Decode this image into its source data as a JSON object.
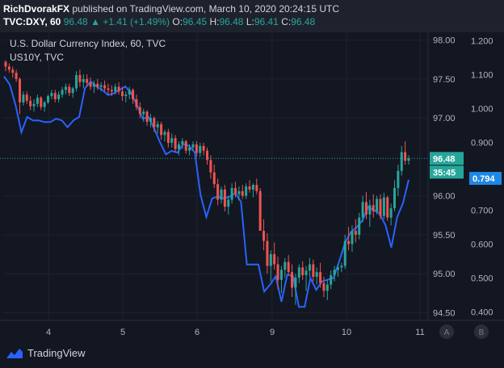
{
  "header": {
    "author": "RichDvorakFX",
    "published_text": "published on TradingView.com, March 10, 2020 20:24:15 UTC",
    "symbol": "TVC:DXY, 60",
    "last": "96.48",
    "arrow": "▲",
    "change": "+1.41 (+1.49%)",
    "open_label": "O:",
    "open": "96.45",
    "high_label": "H:",
    "high": "96.48",
    "low_label": "L:",
    "low": "96.41",
    "close_label": "C:",
    "close": "96.48"
  },
  "legend": {
    "main_series": "U.S. Dollar Currency Index, 60, TVC",
    "overlay_series": "US10Y, TVC"
  },
  "footer": {
    "brand": "TradingView"
  },
  "axis_buttons": [
    "A",
    "B"
  ],
  "colors": {
    "background": "#131722",
    "up": "#26a69a",
    "down": "#ef5350",
    "overlay": "#2962ff",
    "price_tag": "#26a69a",
    "overlay_tag": "#1e88e5"
  },
  "chart_data": {
    "type": "candlestick",
    "x_ticks": [
      "4",
      "5",
      "6",
      "9",
      "10",
      "11"
    ],
    "left_axis": {
      "ticks": [
        "98.00",
        "97.50",
        "97.00",
        "96.00",
        "95.50",
        "95.00",
        "94.50"
      ],
      "range": [
        94.4,
        98.1
      ]
    },
    "right_axis": {
      "ticks": [
        "1.200",
        "1.100",
        "1.000",
        "0.900",
        "0.800",
        "0.700",
        "0.600",
        "0.500",
        "0.400"
      ],
      "range": [
        0.375,
        1.225
      ]
    },
    "price_label": "96.48",
    "countdown_label": "35:45",
    "overlay_label": "0.794",
    "candles": [
      [
        97.72,
        97.74,
        97.6,
        97.66
      ],
      [
        97.66,
        97.7,
        97.58,
        97.62
      ],
      [
        97.62,
        97.66,
        97.52,
        97.58
      ],
      [
        97.58,
        97.62,
        97.46,
        97.5
      ],
      [
        97.5,
        97.52,
        97.05,
        97.2
      ],
      [
        97.2,
        97.34,
        97.16,
        97.3
      ],
      [
        97.3,
        97.34,
        97.18,
        97.22
      ],
      [
        97.22,
        97.28,
        97.1,
        97.15
      ],
      [
        97.15,
        97.24,
        97.08,
        97.18
      ],
      [
        97.18,
        97.3,
        97.14,
        97.26
      ],
      [
        97.26,
        97.28,
        97.1,
        97.14
      ],
      [
        97.14,
        97.22,
        97.08,
        97.2
      ],
      [
        97.2,
        97.3,
        97.18,
        97.28
      ],
      [
        97.28,
        97.36,
        97.24,
        97.32
      ],
      [
        97.32,
        97.36,
        97.2,
        97.24
      ],
      [
        97.24,
        97.34,
        97.2,
        97.3
      ],
      [
        97.3,
        97.4,
        97.26,
        97.36
      ],
      [
        97.36,
        97.44,
        97.3,
        97.4
      ],
      [
        97.4,
        97.44,
        97.28,
        97.32
      ],
      [
        97.32,
        97.4,
        97.26,
        97.38
      ],
      [
        97.38,
        97.6,
        97.34,
        97.55
      ],
      [
        97.55,
        97.62,
        97.4,
        97.46
      ],
      [
        97.46,
        97.56,
        97.38,
        97.5
      ],
      [
        97.5,
        97.56,
        97.4,
        97.45
      ],
      [
        97.45,
        97.52,
        97.36,
        97.4
      ],
      [
        97.4,
        97.48,
        97.32,
        97.44
      ],
      [
        97.44,
        97.5,
        97.36,
        97.4
      ],
      [
        97.4,
        97.46,
        97.34,
        97.42
      ],
      [
        97.42,
        97.48,
        97.34,
        97.38
      ],
      [
        97.38,
        97.44,
        97.3,
        97.36
      ],
      [
        97.36,
        97.42,
        97.28,
        97.34
      ],
      [
        97.34,
        97.44,
        97.3,
        97.4
      ],
      [
        97.4,
        97.46,
        97.3,
        97.34
      ],
      [
        97.34,
        97.4,
        97.22,
        97.28
      ],
      [
        97.28,
        97.34,
        97.2,
        97.3
      ],
      [
        97.3,
        97.4,
        97.24,
        97.36
      ],
      [
        97.36,
        97.38,
        97.18,
        97.24
      ],
      [
        97.24,
        97.3,
        97.1,
        97.14
      ],
      [
        97.14,
        97.2,
        97.0,
        97.05
      ],
      [
        97.05,
        97.12,
        96.95,
        97.08
      ],
      [
        97.08,
        97.1,
        96.9,
        96.95
      ],
      [
        96.95,
        97.05,
        96.88,
        97.0
      ],
      [
        97.0,
        97.02,
        96.82,
        96.88
      ],
      [
        96.88,
        96.96,
        96.8,
        96.92
      ],
      [
        96.92,
        96.95,
        96.72,
        96.78
      ],
      [
        96.78,
        96.85,
        96.7,
        96.82
      ],
      [
        96.82,
        96.86,
        96.62,
        96.68
      ],
      [
        96.68,
        96.8,
        96.62,
        96.74
      ],
      [
        96.74,
        96.78,
        96.56,
        96.6
      ],
      [
        96.6,
        96.7,
        96.52,
        96.66
      ],
      [
        96.66,
        96.74,
        96.6,
        96.7
      ],
      [
        96.7,
        96.72,
        96.54,
        96.58
      ],
      [
        96.58,
        96.66,
        96.52,
        96.62
      ],
      [
        96.62,
        96.7,
        96.58,
        96.66
      ],
      [
        96.66,
        96.7,
        96.5,
        96.55
      ],
      [
        96.55,
        96.68,
        96.5,
        96.64
      ],
      [
        96.64,
        96.68,
        96.52,
        96.58
      ],
      [
        96.58,
        96.62,
        96.4,
        96.46
      ],
      [
        96.46,
        96.52,
        96.22,
        96.3
      ],
      [
        96.3,
        96.4,
        96.1,
        96.15
      ],
      [
        96.15,
        96.22,
        95.88,
        95.95
      ],
      [
        95.95,
        96.12,
        95.9,
        96.08
      ],
      [
        96.08,
        96.14,
        95.8,
        95.86
      ],
      [
        95.86,
        96.0,
        95.76,
        95.95
      ],
      [
        95.95,
        96.16,
        95.9,
        96.1
      ],
      [
        96.1,
        96.18,
        95.98,
        96.02
      ],
      [
        96.02,
        96.12,
        95.94,
        96.06
      ],
      [
        96.06,
        96.14,
        95.96,
        96.0
      ],
      [
        96.0,
        96.16,
        95.96,
        96.12
      ],
      [
        96.12,
        96.2,
        96.04,
        96.08
      ],
      [
        96.08,
        96.16,
        95.98,
        96.14
      ],
      [
        96.14,
        96.22,
        96.02,
        96.06
      ],
      [
        96.06,
        96.1,
        95.74,
        95.55
      ],
      [
        95.55,
        95.7,
        95.3,
        95.42
      ],
      [
        95.42,
        95.52,
        95.0,
        95.1
      ],
      [
        95.1,
        95.3,
        94.9,
        95.25
      ],
      [
        95.25,
        95.4,
        95.05,
        95.12
      ],
      [
        95.12,
        95.22,
        94.8,
        94.92
      ],
      [
        94.92,
        95.1,
        94.75,
        95.05
      ],
      [
        95.05,
        95.2,
        94.95,
        95.15
      ],
      [
        95.15,
        95.24,
        94.98,
        95.02
      ],
      [
        95.02,
        95.12,
        94.7,
        94.82
      ],
      [
        94.82,
        95.0,
        94.6,
        94.95
      ],
      [
        94.95,
        95.12,
        94.88,
        95.08
      ],
      [
        95.08,
        95.16,
        94.92,
        94.98
      ],
      [
        94.98,
        95.1,
        94.78,
        95.04
      ],
      [
        95.04,
        95.2,
        94.96,
        95.12
      ],
      [
        95.12,
        95.18,
        94.9,
        94.96
      ],
      [
        94.96,
        95.08,
        94.86,
        95.02
      ],
      [
        95.02,
        95.14,
        94.82,
        94.88
      ],
      [
        94.88,
        94.96,
        94.7,
        94.78
      ],
      [
        94.78,
        94.92,
        94.66,
        94.86
      ],
      [
        94.86,
        95.04,
        94.8,
        94.98
      ],
      [
        94.98,
        95.1,
        94.9,
        95.05
      ],
      [
        95.05,
        95.12,
        94.96,
        95.08
      ],
      [
        95.08,
        95.14,
        95.02,
        95.1
      ],
      [
        95.1,
        95.5,
        95.06,
        95.42
      ],
      [
        95.42,
        95.6,
        95.3,
        95.38
      ],
      [
        95.38,
        95.62,
        95.28,
        95.55
      ],
      [
        95.55,
        95.7,
        95.4,
        95.5
      ],
      [
        95.5,
        95.78,
        95.44,
        95.72
      ],
      [
        95.72,
        96.0,
        95.66,
        95.92
      ],
      [
        95.92,
        96.05,
        95.7,
        95.76
      ],
      [
        95.76,
        95.95,
        95.6,
        95.88
      ],
      [
        95.88,
        96.02,
        95.72,
        95.8
      ],
      [
        95.8,
        96.0,
        95.76,
        95.96
      ],
      [
        95.96,
        96.02,
        95.7,
        95.74
      ],
      [
        95.74,
        96.04,
        95.7,
        95.98
      ],
      [
        95.98,
        96.0,
        95.68,
        95.72
      ],
      [
        95.72,
        95.9,
        95.62,
        95.84
      ],
      [
        95.84,
        96.2,
        95.8,
        96.1
      ],
      [
        96.1,
        96.4,
        96.0,
        96.32
      ],
      [
        96.32,
        96.64,
        96.26,
        96.56
      ],
      [
        96.56,
        96.7,
        96.4,
        96.45
      ],
      [
        96.45,
        96.52,
        96.4,
        96.48
      ]
    ],
    "overlay_series": [
      1.095,
      1.07,
      1.01,
      0.93,
      0.975,
      0.965,
      0.965,
      0.96,
      0.96,
      0.97,
      0.965,
      0.945,
      0.965,
      0.975,
      1.06,
      1.08,
      1.065,
      1.055,
      1.04,
      1.045,
      1.055,
      1.065,
      1.045,
      1.01,
      0.97,
      0.975,
      0.94,
      0.9,
      0.865,
      0.875,
      0.87,
      0.895,
      0.89,
      0.87,
      0.745,
      0.68,
      0.735,
      0.74,
      0.735,
      0.74,
      0.75,
      0.725,
      0.54,
      0.54,
      0.54,
      0.46,
      0.48,
      0.505,
      0.43,
      0.51,
      0.505,
      0.415,
      0.415,
      0.5,
      0.465,
      0.49,
      0.495,
      0.5,
      0.55,
      0.605,
      0.635,
      0.65,
      0.67,
      0.71,
      0.7,
      0.69,
      0.655,
      0.59,
      0.68,
      0.72,
      0.79
    ]
  }
}
